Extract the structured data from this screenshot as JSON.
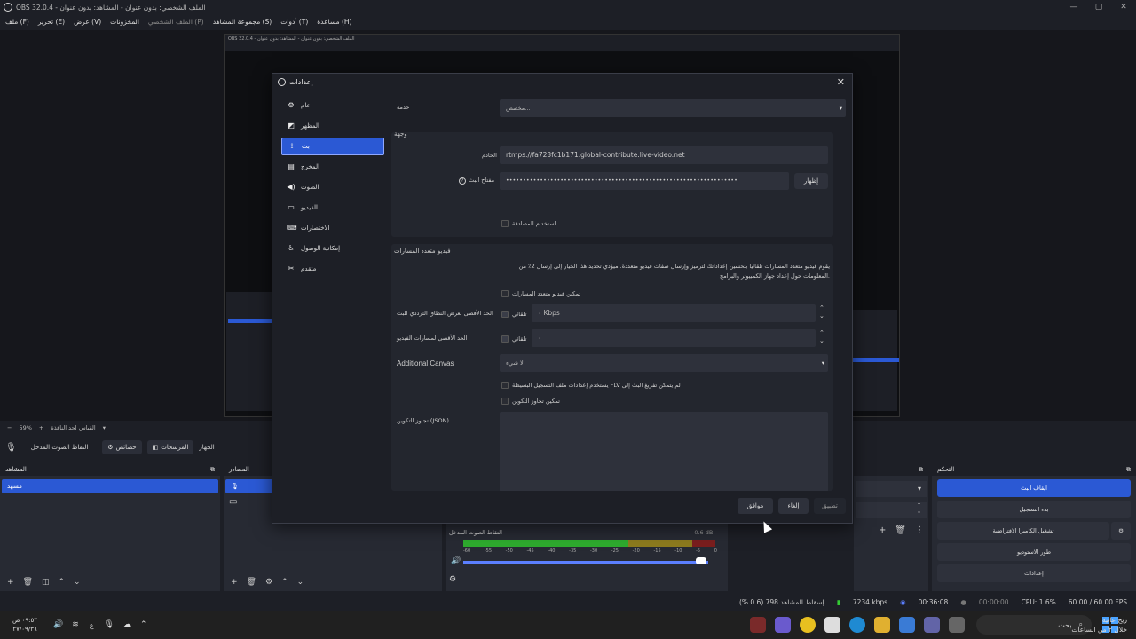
{
  "window": {
    "title": "OBS 32.0.4 - الملف الشخصي: بدون عنوان - المشاهد: بدون عنوان",
    "controls": [
      "—",
      "▢",
      "✕"
    ]
  },
  "menu": [
    "ملف (F)",
    "تحرير (E)",
    "عرض (V)",
    "المخزونات",
    "الملف الشخصي (P)",
    "مجموعة المشاهد (S)",
    "أدوات (T)",
    "مساعدة (H)"
  ],
  "preview": {
    "zoom": "59%",
    "zoom_label": "القياس لحد النافذة"
  },
  "toolbar": {
    "audio_label": "التقاط الصوت المدخل",
    "properties": "خصائص",
    "filters": "المرشحات",
    "device": "الجهاز"
  },
  "docks": {
    "scenes_title": "المشاهد",
    "scene_item": "مشهد",
    "sources_title": "المصادر",
    "mixer_title": "التقاط الصوت المدخل",
    "mixer_level": "-0.6 dB",
    "mixer_scale": [
      "-60",
      "-55",
      "-50",
      "-45",
      "-40",
      "-35",
      "-30",
      "-25",
      "-20",
      "-15",
      "-10",
      "-5",
      "0"
    ],
    "controls_title": "التحكم",
    "controls_buttons": [
      "ايقاف البث",
      "بدء التسجيل",
      "تشغيل الكاميرا الافتراضية",
      "طور الاستوديو",
      "إعدادات"
    ]
  },
  "status": {
    "dropped": "إسقاط المشاهد 798 (0.6 %)",
    "bitrate": "7234 kbps",
    "stream_time": "00:36:08",
    "rec_time": "00:00:00",
    "cpu": "CPU: 1.6%",
    "fps": "60.00 / 60.00 FPS"
  },
  "taskbar": {
    "time": "٠٩:٥٣ ص",
    "date": "٢٧/٠٩/٣٦",
    "search": "بحث",
    "lang": "ع",
    "notif_title": "ريح عاتية",
    "notif_sub": "خلال ٢ من الساعات"
  },
  "settings": {
    "title": "إعدادات",
    "nav": [
      "عام",
      "المظهر",
      "بث",
      "المخرج",
      "الصوت",
      "الفيديو",
      "الاختصارات",
      "إمكانية الوصول",
      "متقدم"
    ],
    "nav_icons": [
      "gear-icon",
      "palette-icon",
      "antenna-icon",
      "output-icon",
      "speaker-icon",
      "monitor-icon",
      "keyboard-icon",
      "accessibility-icon",
      "tools-icon"
    ],
    "service_label": "خدمة",
    "service_value": "مخصص...",
    "destination_label": "وجهة",
    "server_label": "الخادم",
    "server_value": "rtmps://fa723fc1b171.global-contribute.live-video.net",
    "key_label": "مفتاح البث",
    "key_value": "••••••••••••••••••••••••••••••••••••••••••••••••••••••••••••••••••••",
    "show_button": "إظهار",
    "use_auth": "استخدام المصادقة",
    "multitrack_title": "فيديو متعدد المسارات",
    "multitrack_desc": "يقوم فيديو متعدد المسارات تلقائيا بتحسين إعداداتك لترميز وإرسال صفات فيديو متعددة. ميؤدي تحديد هذا الخيار إلى إرسال 2٪ من المعلومات حول إعداد جهاز الكمبيوتر والبرامج.",
    "enable_multitrack": "تمكين فيديو متعدد المسارات",
    "max_bw_label": "الحد الأقصى لعرض النطاق الترددي للبث",
    "auto": "تلقائي",
    "max_bw_value": "٠ Kbps",
    "max_tracks_label": "الحد الأقصى لمسارات الفيديو",
    "max_tracks_value": "٠",
    "additional_canvas_label": "Additional Canvas",
    "additional_canvas_value": "لا شيء",
    "flv_option": "يستخدم إعدادات ملف التسجيل البسيطة FLV لم يتمكن تفريغ البث إلى",
    "config_override_enable": "تمكين تجاوز التكوين",
    "config_override_label": "تجاوز التكوين (JSON)",
    "ok": "موافق",
    "cancel": "إلغاء",
    "apply": "تطبيق"
  }
}
